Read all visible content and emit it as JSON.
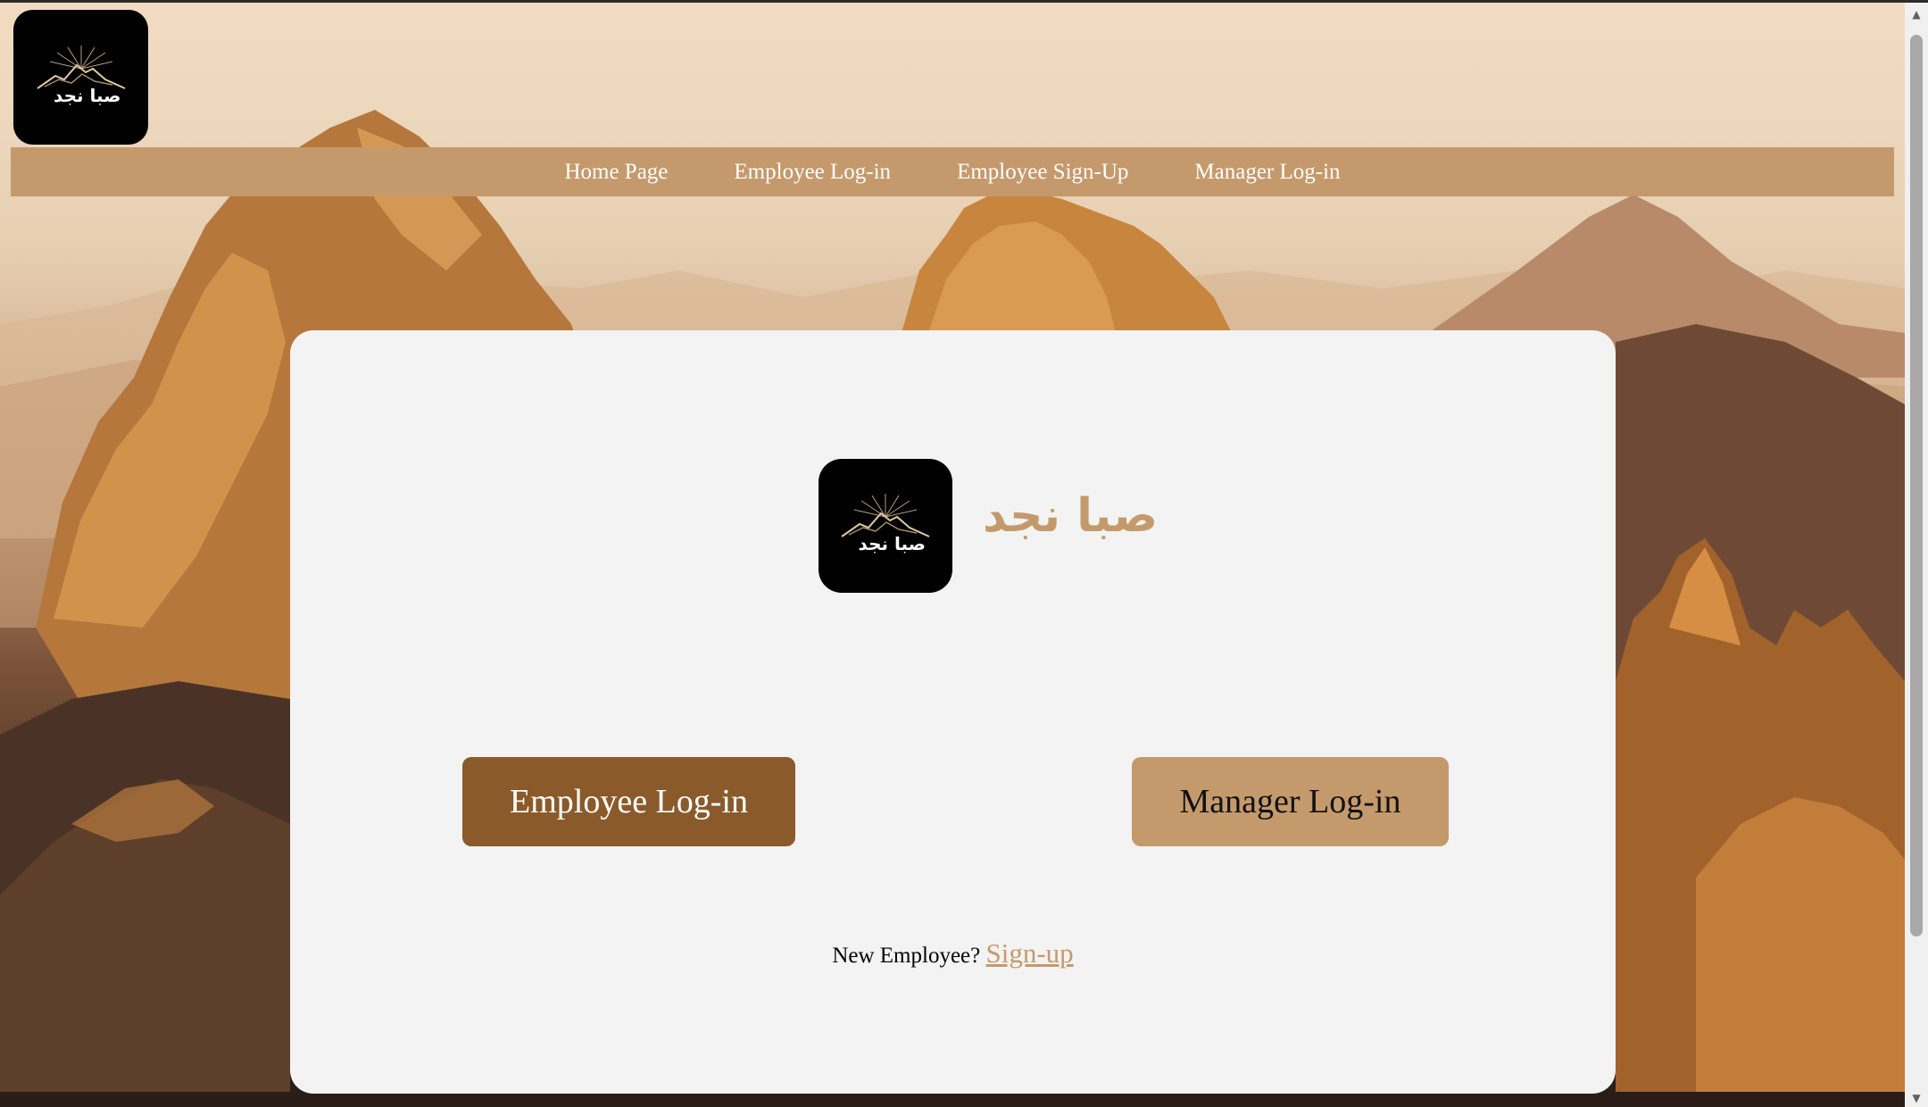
{
  "brand": {
    "logo_text": "صبا نجد",
    "name": "صبا نجد"
  },
  "nav": {
    "items": [
      {
        "label": "Home Page"
      },
      {
        "label": "Employee Log-in"
      },
      {
        "label": "Employee Sign-Up"
      },
      {
        "label": "Manager Log-in"
      }
    ]
  },
  "main": {
    "employee_login_label": "Employee Log-in",
    "manager_login_label": "Manager Log-in",
    "signup_prompt": "New Employee?",
    "signup_link": "Sign-up"
  },
  "colors": {
    "accent": "#c49a6c",
    "accent_dark": "#8b5a2b",
    "card_bg": "#f3f3f3"
  },
  "icons": {
    "scroll_up": "scroll-up-arrow-icon",
    "scroll_down": "scroll-down-arrow-icon"
  }
}
